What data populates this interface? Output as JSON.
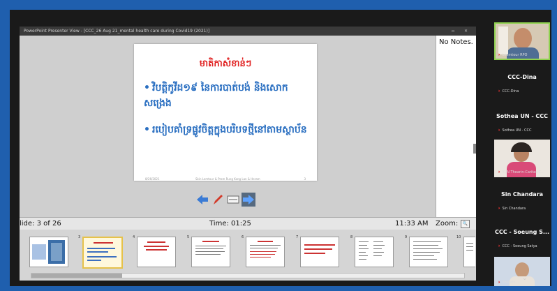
{
  "window": {
    "title": "PowerPoint Presenter View - [CCC_26 Aug 21_mental health care during Covid19 (2021)]"
  },
  "slide": {
    "heading": "មាតិកាសំខាន់ៗ",
    "bullets": [
      "វិបត្តិកូវីដ១៩ នៃការបាត់បង់ និងសោកសង្រេង",
      "របៀបគាំទ្រផ្លូវចិត្តក្នុងបរិបទថ្មីនៅតាមស្ថាប័ន"
    ],
    "footer_left": "8/26/2021",
    "footer_center": "Skin Lemtour & Prom Rung Kong Lan & Heram",
    "footer_right": "3"
  },
  "notes": {
    "text": "No Notes."
  },
  "status": {
    "slide": "lide: 3 of 26",
    "time": "Time: 01:25",
    "clock": "11:33 AM",
    "zoom": "Zoom:"
  },
  "thumbnails": [
    {
      "n": "1"
    },
    {
      "n": "3"
    },
    {
      "n": "4"
    },
    {
      "n": "5"
    },
    {
      "n": "6"
    },
    {
      "n": "7"
    },
    {
      "n": "8"
    },
    {
      "n": "9"
    },
    {
      "n": "10"
    }
  ],
  "participants": [
    {
      "name": "",
      "sub": "Leemtour RPO"
    },
    {
      "name": "CCC-Dina",
      "sub": "CCC-Dina"
    },
    {
      "name": "Sothea UN - CCC",
      "sub": "Sothea UN - CCC"
    },
    {
      "name": "",
      "sub": "YUN Thearin-Caritas C..."
    },
    {
      "name": "Sin Chandara",
      "sub": "Sin Chandara"
    },
    {
      "name": "CCC - Soeung S...",
      "sub": "CCC - Soeung Satya"
    },
    {
      "name": "",
      "sub": "Thearin..."
    }
  ],
  "colors": {
    "accent_blue": "#1f5fae",
    "slide_heading": "#e02020",
    "slide_text": "#2a6fc1",
    "active_speaker": "#8fd14f"
  }
}
